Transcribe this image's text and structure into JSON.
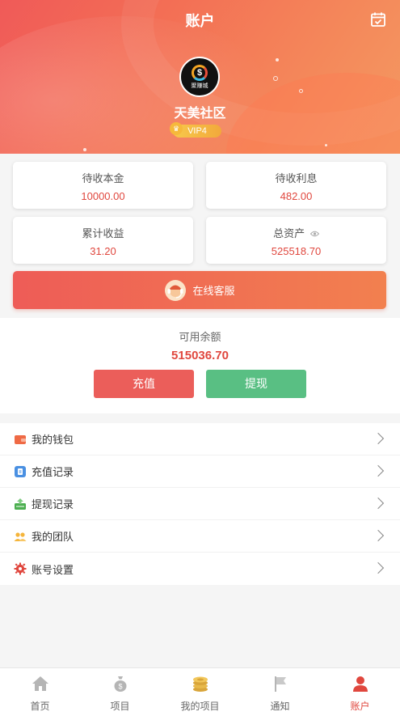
{
  "header": {
    "title": "账户",
    "calendar_icon": "calendar-check-icon",
    "avatar_text": "聚赚城",
    "avatar_symbol": "$",
    "username": "天美社区",
    "vip_level": "VIP4",
    "gradient_from": "#f05a58",
    "gradient_to": "#f39a62"
  },
  "stats": {
    "pending_principal": {
      "label": "待收本金",
      "value": "10000.00"
    },
    "pending_interest": {
      "label": "待收利息",
      "value": "482.00"
    },
    "total_earnings": {
      "label": "累计收益",
      "value": "31.20"
    },
    "total_assets": {
      "label": "总资产",
      "value": "525518.70",
      "icon": "eye-icon"
    }
  },
  "service": {
    "label": "在线客服",
    "icon": "headset-icon"
  },
  "balance": {
    "label": "可用余额",
    "amount": "515036.70",
    "recharge_label": "充值",
    "withdraw_label": "提现",
    "recharge_color": "#eb5e5a",
    "withdraw_color": "#59bf83"
  },
  "menu": {
    "items": [
      {
        "label": "我的钱包",
        "icon": "wallet-icon",
        "color": "#ef6a45"
      },
      {
        "label": "充值记录",
        "icon": "recharge-record-icon",
        "color": "#4a90e2"
      },
      {
        "label": "提现记录",
        "icon": "withdraw-record-icon",
        "color": "#4caf50"
      },
      {
        "label": "我的团队",
        "icon": "team-icon",
        "color": "#f5b53b"
      },
      {
        "label": "账号设置",
        "icon": "settings-gear-icon",
        "color": "#e0473e"
      }
    ]
  },
  "tabbar": {
    "items": [
      {
        "label": "首页",
        "icon": "home-icon",
        "active": false
      },
      {
        "label": "项目",
        "icon": "money-bag-icon",
        "active": false
      },
      {
        "label": "我的项目",
        "icon": "coin-stack-icon",
        "active": false
      },
      {
        "label": "通知",
        "icon": "flag-icon",
        "active": false
      },
      {
        "label": "账户",
        "icon": "user-icon",
        "active": true
      }
    ],
    "active_color": "#e0473e"
  }
}
